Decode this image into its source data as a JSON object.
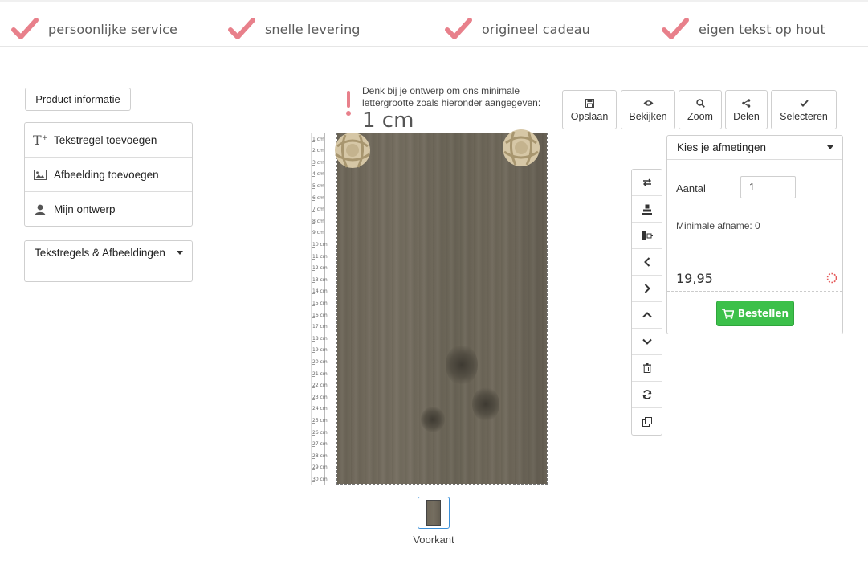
{
  "usp": [
    {
      "label": "persoonlijke service",
      "icon": "check-icon"
    },
    {
      "label": "snelle levering",
      "icon": "check-icon"
    },
    {
      "label": "origineel cadeau",
      "icon": "check-icon"
    },
    {
      "label": "eigen tekst op hout",
      "icon": "check-icon"
    }
  ],
  "colors": {
    "check": "#e8808b",
    "order_button": "#3cc04a",
    "thumb_border": "#3b8fd8",
    "spinner": "#e55a5a"
  },
  "left_panel": {
    "product_info_label": "Product informatie",
    "tools": [
      {
        "label": "Tekstregel toevoegen",
        "icon": "text-add-icon"
      },
      {
        "label": "Afbeelding toevoegen",
        "icon": "image-icon"
      },
      {
        "label": "Mijn ontwerp",
        "icon": "user-icon"
      }
    ],
    "layers_label": "Tekstregels & Afbeeldingen"
  },
  "hint": {
    "text_line1": "Denk bij je ontwerp om ons minimale",
    "text_line2": "lettergrootte zoals hieronder aangegeven:",
    "size": "1 cm"
  },
  "ruler": {
    "labels": [
      "1 cm",
      "2 cm",
      "3 cm",
      "4 cm",
      "5 cm",
      "6 cm",
      "7 cm",
      "8 cm",
      "9 cm",
      "10 cm",
      "11 cm",
      "12 cm",
      "13 cm",
      "14 cm",
      "15 cm",
      "16 cm",
      "17 cm",
      "18 cm",
      "19 cm",
      "20 cm",
      "21 cm",
      "22 cm",
      "23 cm",
      "24 cm",
      "25 cm",
      "26 cm",
      "27 cm",
      "28 cm",
      "29 cm",
      "30 cm"
    ]
  },
  "thumbnail": {
    "label": "Voorkant"
  },
  "toolbar": [
    {
      "label": "Opslaan",
      "icon": "save-icon"
    },
    {
      "label": "Bekijken",
      "icon": "eye-icon"
    },
    {
      "label": "Zoom",
      "icon": "search-icon"
    },
    {
      "label": "Delen",
      "icon": "share-icon"
    },
    {
      "label": "Selecteren",
      "icon": "check-icon"
    }
  ],
  "vertical_tools": [
    "swap-icon",
    "align-bottom-icon",
    "align-center-icon",
    "chevron-left-icon",
    "chevron-right-icon",
    "chevron-up-icon",
    "chevron-down-icon",
    "trash-icon",
    "refresh-icon",
    "duplicate-icon"
  ],
  "order": {
    "size_label": "Kies je afmetingen",
    "qty_label": "Aantal",
    "qty_value": "1",
    "minimal_text": "Minimale afname: 0",
    "price": "19,95",
    "order_button": "Bestellen"
  }
}
